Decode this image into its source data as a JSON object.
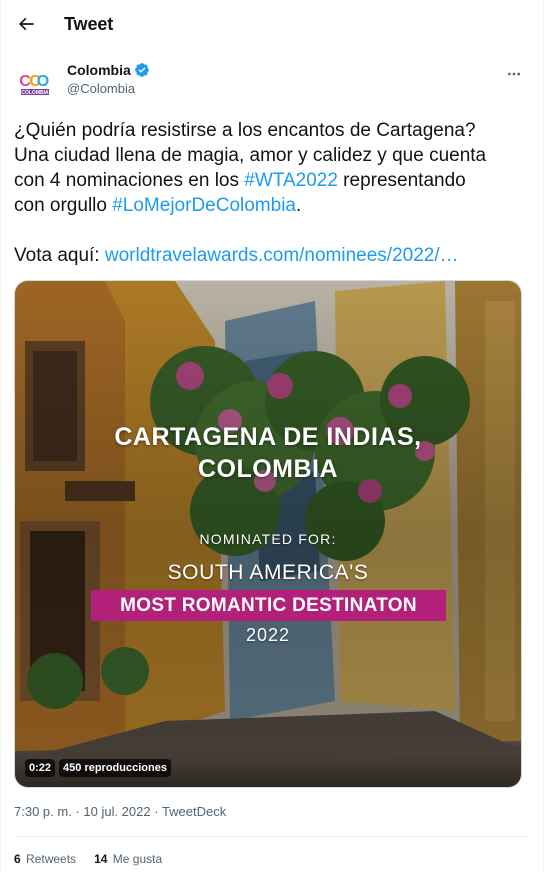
{
  "header": {
    "title": "Tweet",
    "back_icon": "arrow-left-icon"
  },
  "author": {
    "display_name": "Colombia",
    "handle": "@Colombia",
    "verified_icon": "verified-badge-icon",
    "avatar_text": "CO",
    "avatar_subtext": "COLOMBIA",
    "more_icon": "more-horizontal-icon"
  },
  "tweet": {
    "line1": "¿Quién podría resistirse a los encantos de Cartagena?",
    "line2": "Una ciudad llena de magia, amor y calidez y que cuenta",
    "line3_pre": "con 4 nominaciones en los ",
    "hashtag1": "#WTA2022",
    "line3_post": " representando",
    "line4_pre": "con orgullo ",
    "hashtag2": "#LoMejorDeColombia",
    "line4_post": ".",
    "vote_label": "Vota aquí: ",
    "vote_link": "worldtravelawards.com/nominees/2022/…"
  },
  "media": {
    "headline1": "CARTAGENA DE INDIAS,",
    "headline2": "COLOMBIA",
    "nominated": "NOMINATED FOR:",
    "category1": "SOUTH AMERICA'S",
    "category2": "MOST ROMANTIC DESTINATON",
    "year": "2022",
    "duration": "0:22",
    "views": "450 reproducciones"
  },
  "meta": {
    "time": "7:30 p. m.",
    "separator": " · ",
    "date": "10 jul. 2022",
    "source": "TweetDeck"
  },
  "stats": {
    "retweets_count": "6",
    "retweets_label": "Retweets",
    "likes_count": "14",
    "likes_label": "Me gusta"
  },
  "colors": {
    "link": "#1d9bf0",
    "text": "#0f1419",
    "secondary": "#536471",
    "banner": "#b3207a"
  }
}
